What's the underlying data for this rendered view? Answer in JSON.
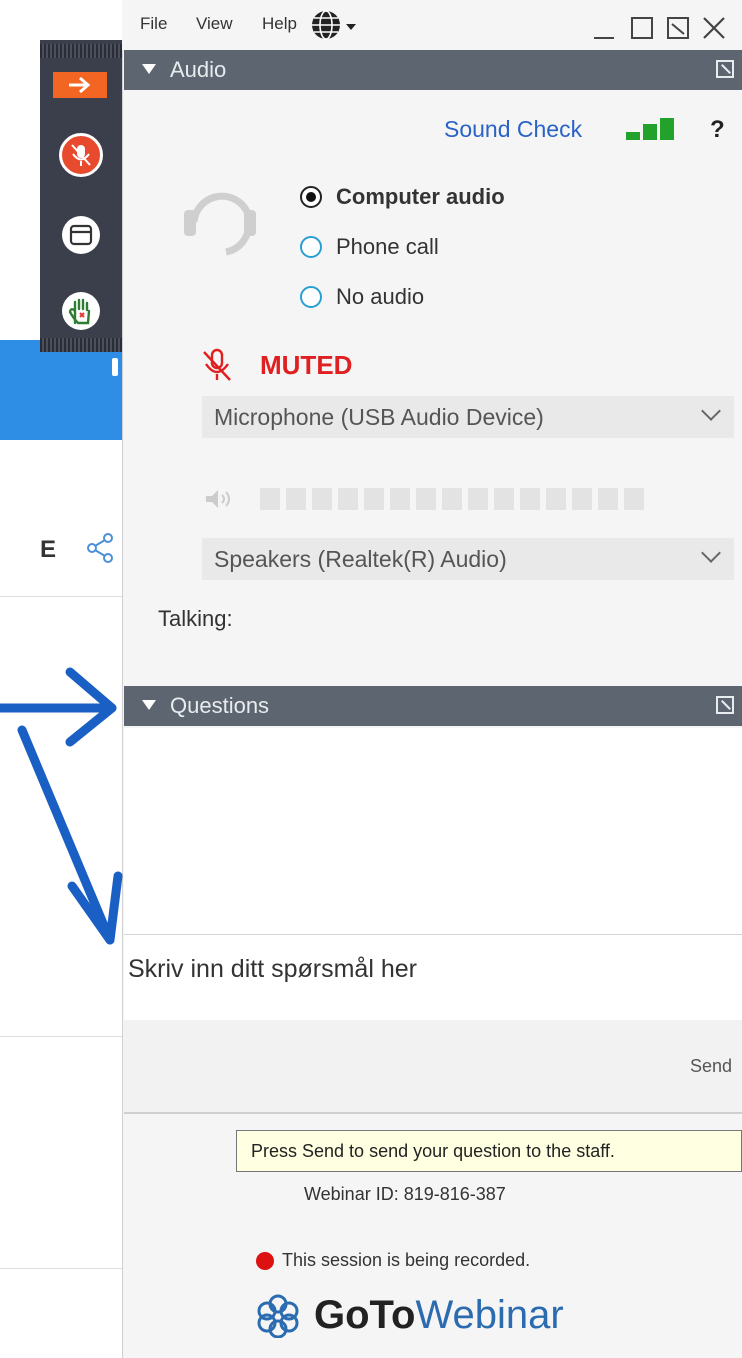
{
  "menubar": {
    "items": [
      "File",
      "View",
      "Help"
    ],
    "language_icon": "globe-icon",
    "window_controls": [
      "minimize-icon",
      "maximize-icon",
      "restore-icon",
      "close-icon"
    ]
  },
  "toolbar": {
    "buttons": [
      "arrow-right-icon",
      "microphone-icon",
      "window-icon",
      "raise-hand-icon"
    ]
  },
  "audio": {
    "header": "Audio",
    "sound_check": "Sound Check",
    "help": "?",
    "options": [
      {
        "label": "Computer audio",
        "selected": true
      },
      {
        "label": "Phone call",
        "selected": false
      },
      {
        "label": "No audio",
        "selected": false
      }
    ],
    "mute_status": "MUTED",
    "microphone": "Microphone (USB Audio Device)",
    "speakers": "Speakers (Realtek(R) Audio)",
    "talking_label": "Talking:"
  },
  "questions": {
    "header": "Questions",
    "placeholder": "Skriv inn ditt spørsmål her",
    "send_label": "Send",
    "tooltip": "Press Send to send your question to the staff."
  },
  "footer": {
    "webinar_id": "Webinar ID: 819-816-387",
    "recording": "This session is being recorded.",
    "brand_bold": "GoTo",
    "brand_light": "Webinar"
  },
  "colors": {
    "accent_blue": "#2a63c6",
    "muted_red": "#e02020",
    "annotation_arrow": "#1a5fc4",
    "header_bg": "#5d6570"
  }
}
